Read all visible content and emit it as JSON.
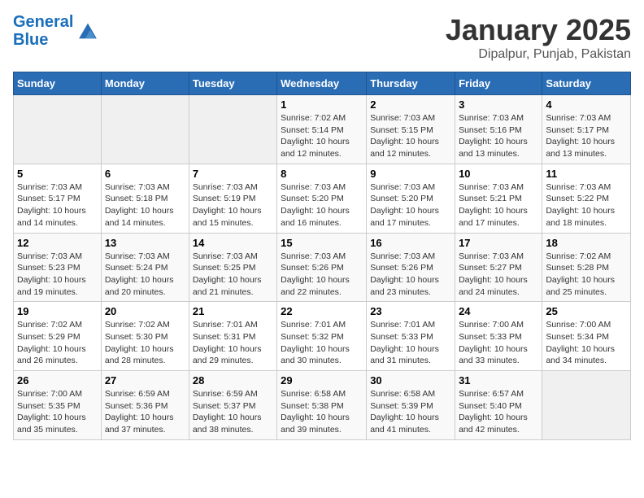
{
  "header": {
    "logo_line1": "General",
    "logo_line2": "Blue",
    "title": "January 2025",
    "subtitle": "Dipalpur, Punjab, Pakistan"
  },
  "weekdays": [
    "Sunday",
    "Monday",
    "Tuesday",
    "Wednesday",
    "Thursday",
    "Friday",
    "Saturday"
  ],
  "weeks": [
    [
      {
        "num": "",
        "info": ""
      },
      {
        "num": "",
        "info": ""
      },
      {
        "num": "",
        "info": ""
      },
      {
        "num": "1",
        "info": "Sunrise: 7:02 AM\nSunset: 5:14 PM\nDaylight: 10 hours\nand 12 minutes."
      },
      {
        "num": "2",
        "info": "Sunrise: 7:03 AM\nSunset: 5:15 PM\nDaylight: 10 hours\nand 12 minutes."
      },
      {
        "num": "3",
        "info": "Sunrise: 7:03 AM\nSunset: 5:16 PM\nDaylight: 10 hours\nand 13 minutes."
      },
      {
        "num": "4",
        "info": "Sunrise: 7:03 AM\nSunset: 5:17 PM\nDaylight: 10 hours\nand 13 minutes."
      }
    ],
    [
      {
        "num": "5",
        "info": "Sunrise: 7:03 AM\nSunset: 5:17 PM\nDaylight: 10 hours\nand 14 minutes."
      },
      {
        "num": "6",
        "info": "Sunrise: 7:03 AM\nSunset: 5:18 PM\nDaylight: 10 hours\nand 14 minutes."
      },
      {
        "num": "7",
        "info": "Sunrise: 7:03 AM\nSunset: 5:19 PM\nDaylight: 10 hours\nand 15 minutes."
      },
      {
        "num": "8",
        "info": "Sunrise: 7:03 AM\nSunset: 5:20 PM\nDaylight: 10 hours\nand 16 minutes."
      },
      {
        "num": "9",
        "info": "Sunrise: 7:03 AM\nSunset: 5:20 PM\nDaylight: 10 hours\nand 17 minutes."
      },
      {
        "num": "10",
        "info": "Sunrise: 7:03 AM\nSunset: 5:21 PM\nDaylight: 10 hours\nand 17 minutes."
      },
      {
        "num": "11",
        "info": "Sunrise: 7:03 AM\nSunset: 5:22 PM\nDaylight: 10 hours\nand 18 minutes."
      }
    ],
    [
      {
        "num": "12",
        "info": "Sunrise: 7:03 AM\nSunset: 5:23 PM\nDaylight: 10 hours\nand 19 minutes."
      },
      {
        "num": "13",
        "info": "Sunrise: 7:03 AM\nSunset: 5:24 PM\nDaylight: 10 hours\nand 20 minutes."
      },
      {
        "num": "14",
        "info": "Sunrise: 7:03 AM\nSunset: 5:25 PM\nDaylight: 10 hours\nand 21 minutes."
      },
      {
        "num": "15",
        "info": "Sunrise: 7:03 AM\nSunset: 5:26 PM\nDaylight: 10 hours\nand 22 minutes."
      },
      {
        "num": "16",
        "info": "Sunrise: 7:03 AM\nSunset: 5:26 PM\nDaylight: 10 hours\nand 23 minutes."
      },
      {
        "num": "17",
        "info": "Sunrise: 7:03 AM\nSunset: 5:27 PM\nDaylight: 10 hours\nand 24 minutes."
      },
      {
        "num": "18",
        "info": "Sunrise: 7:02 AM\nSunset: 5:28 PM\nDaylight: 10 hours\nand 25 minutes."
      }
    ],
    [
      {
        "num": "19",
        "info": "Sunrise: 7:02 AM\nSunset: 5:29 PM\nDaylight: 10 hours\nand 26 minutes."
      },
      {
        "num": "20",
        "info": "Sunrise: 7:02 AM\nSunset: 5:30 PM\nDaylight: 10 hours\nand 28 minutes."
      },
      {
        "num": "21",
        "info": "Sunrise: 7:01 AM\nSunset: 5:31 PM\nDaylight: 10 hours\nand 29 minutes."
      },
      {
        "num": "22",
        "info": "Sunrise: 7:01 AM\nSunset: 5:32 PM\nDaylight: 10 hours\nand 30 minutes."
      },
      {
        "num": "23",
        "info": "Sunrise: 7:01 AM\nSunset: 5:33 PM\nDaylight: 10 hours\nand 31 minutes."
      },
      {
        "num": "24",
        "info": "Sunrise: 7:00 AM\nSunset: 5:33 PM\nDaylight: 10 hours\nand 33 minutes."
      },
      {
        "num": "25",
        "info": "Sunrise: 7:00 AM\nSunset: 5:34 PM\nDaylight: 10 hours\nand 34 minutes."
      }
    ],
    [
      {
        "num": "26",
        "info": "Sunrise: 7:00 AM\nSunset: 5:35 PM\nDaylight: 10 hours\nand 35 minutes."
      },
      {
        "num": "27",
        "info": "Sunrise: 6:59 AM\nSunset: 5:36 PM\nDaylight: 10 hours\nand 37 minutes."
      },
      {
        "num": "28",
        "info": "Sunrise: 6:59 AM\nSunset: 5:37 PM\nDaylight: 10 hours\nand 38 minutes."
      },
      {
        "num": "29",
        "info": "Sunrise: 6:58 AM\nSunset: 5:38 PM\nDaylight: 10 hours\nand 39 minutes."
      },
      {
        "num": "30",
        "info": "Sunrise: 6:58 AM\nSunset: 5:39 PM\nDaylight: 10 hours\nand 41 minutes."
      },
      {
        "num": "31",
        "info": "Sunrise: 6:57 AM\nSunset: 5:40 PM\nDaylight: 10 hours\nand 42 minutes."
      },
      {
        "num": "",
        "info": ""
      }
    ]
  ]
}
